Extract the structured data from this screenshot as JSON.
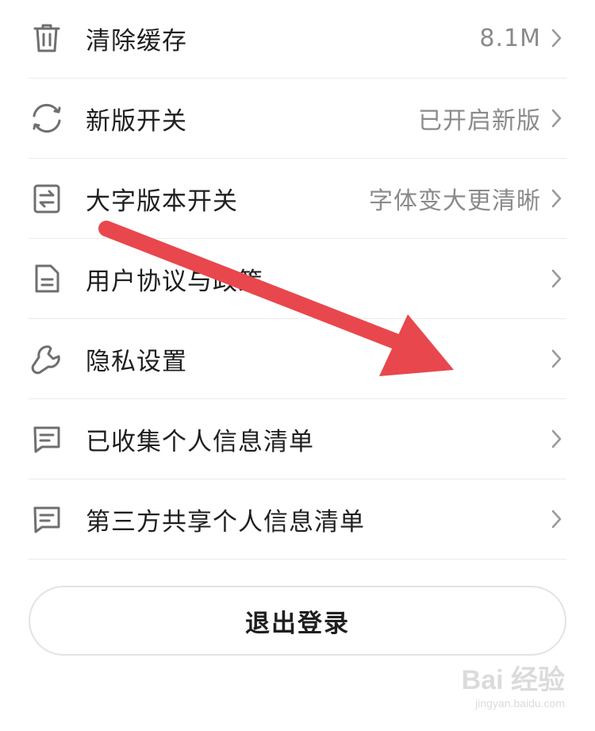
{
  "settings": {
    "items": [
      {
        "id": "clear-cache",
        "icon": "trash-icon",
        "label": "清除缓存",
        "value": "8.1M"
      },
      {
        "id": "new-version",
        "icon": "refresh-icon",
        "label": "新版开关",
        "value": "已开启新版"
      },
      {
        "id": "large-font",
        "icon": "swap-document-icon",
        "label": "大字版本开关",
        "value": "字体变大更清晰"
      },
      {
        "id": "user-agreement",
        "icon": "document-icon",
        "label": "用户协议与政策",
        "value": ""
      },
      {
        "id": "privacy-settings",
        "icon": "wrench-icon",
        "label": "隐私设置",
        "value": ""
      },
      {
        "id": "collected-info",
        "icon": "message-icon",
        "label": "已收集个人信息清单",
        "value": ""
      },
      {
        "id": "third-party-info",
        "icon": "message-icon",
        "label": "第三方共享个人信息清单",
        "value": ""
      }
    ]
  },
  "logout": {
    "label": "退出登录"
  },
  "overlay": {
    "arrow_color": "#e8474d"
  },
  "watermark": {
    "main": "Bai 经验",
    "sub": "jingyan.baidu.com"
  },
  "colors": {
    "icon": "#6f6f6f",
    "value_text": "#8a8a8a",
    "divider": "#ebebeb"
  }
}
